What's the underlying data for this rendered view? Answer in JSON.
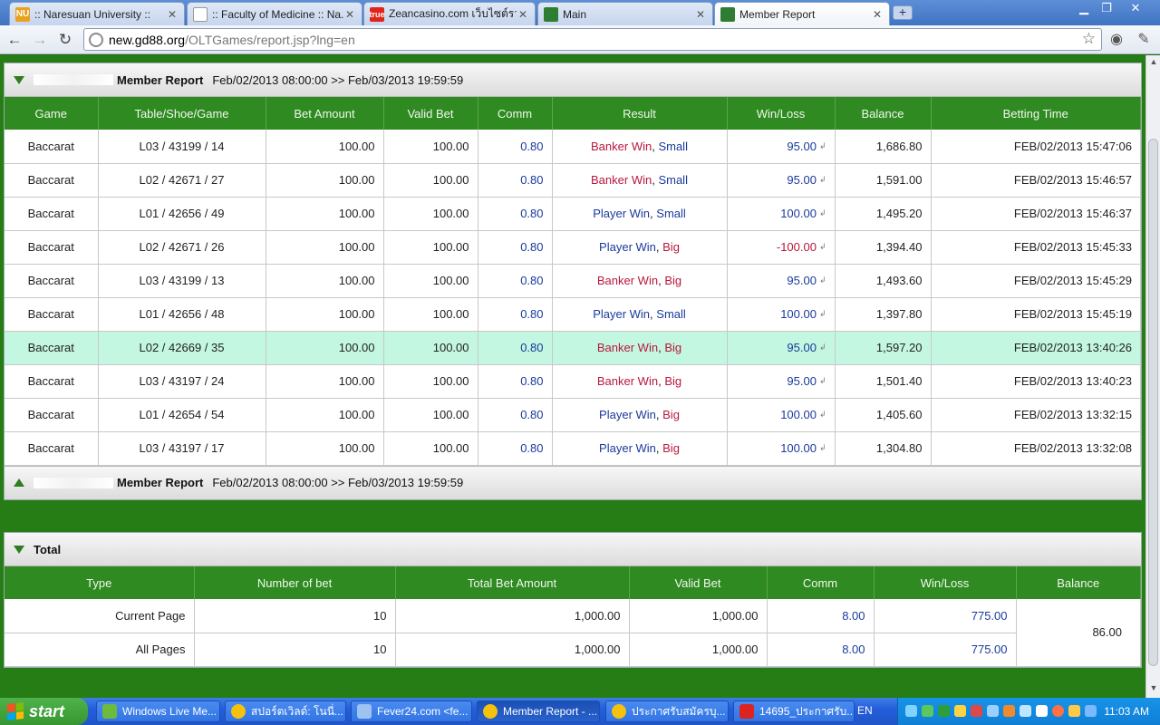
{
  "browser": {
    "tabs": [
      {
        "title": ":: Naresuan University ::",
        "fav": "NU",
        "color": "#e9a21f"
      },
      {
        "title": ":: Faculty of Medicine :: Na...",
        "fav": "",
        "color": "#ffffff"
      },
      {
        "title": "Zeancasino.com เว็บไซต์รว...",
        "fav": "true",
        "color": "#e2231a"
      },
      {
        "title": "Main",
        "fav": "",
        "color": "#2e7d32"
      },
      {
        "title": "Member Report",
        "fav": "",
        "color": "#2e7d32"
      }
    ],
    "url_host": "new.gd88.org",
    "url_path": "/OLTGames/report.jsp?lng=en"
  },
  "report1": {
    "title": "Member Report",
    "range": "Feb/02/2013 08:00:00 >> Feb/03/2013 19:59:59",
    "columns": [
      "Game",
      "Table/Shoe/Game",
      "Bet Amount",
      "Valid Bet",
      "Comm",
      "Result",
      "Win/Loss",
      "Balance",
      "Betting Time"
    ],
    "rows": [
      {
        "game": "Baccarat",
        "table": "L03 / 43199 / 14",
        "bet": "100.00",
        "valid": "100.00",
        "comm": "0.80",
        "res1": "Banker Win",
        "res2": "Small",
        "winloss": "95.00",
        "balance": "1,686.80",
        "time": "FEB/02/2013 15:47:06"
      },
      {
        "game": "Baccarat",
        "table": "L02 / 42671 / 27",
        "bet": "100.00",
        "valid": "100.00",
        "comm": "0.80",
        "res1": "Banker Win",
        "res2": "Small",
        "winloss": "95.00",
        "balance": "1,591.00",
        "time": "FEB/02/2013 15:46:57"
      },
      {
        "game": "Baccarat",
        "table": "L01 / 42656 / 49",
        "bet": "100.00",
        "valid": "100.00",
        "comm": "0.80",
        "res1": "Player Win",
        "res2": "Small",
        "winloss": "100.00",
        "balance": "1,495.20",
        "time": "FEB/02/2013 15:46:37"
      },
      {
        "game": "Baccarat",
        "table": "L02 / 42671 / 26",
        "bet": "100.00",
        "valid": "100.00",
        "comm": "0.80",
        "res1": "Player Win",
        "res2": "Big",
        "winloss": "-100.00",
        "balance": "1,394.40",
        "time": "FEB/02/2013 15:45:33"
      },
      {
        "game": "Baccarat",
        "table": "L03 / 43199 / 13",
        "bet": "100.00",
        "valid": "100.00",
        "comm": "0.80",
        "res1": "Banker Win",
        "res2": "Big",
        "winloss": "95.00",
        "balance": "1,493.60",
        "time": "FEB/02/2013 15:45:29"
      },
      {
        "game": "Baccarat",
        "table": "L01 / 42656 / 48",
        "bet": "100.00",
        "valid": "100.00",
        "comm": "0.80",
        "res1": "Player Win",
        "res2": "Small",
        "winloss": "100.00",
        "balance": "1,397.80",
        "time": "FEB/02/2013 15:45:19"
      },
      {
        "game": "Baccarat",
        "table": "L02 / 42669 / 35",
        "bet": "100.00",
        "valid": "100.00",
        "comm": "0.80",
        "res1": "Banker Win",
        "res2": "Big",
        "winloss": "95.00",
        "balance": "1,597.20",
        "time": "FEB/02/2013 13:40:26"
      },
      {
        "game": "Baccarat",
        "table": "L03 / 43197 / 24",
        "bet": "100.00",
        "valid": "100.00",
        "comm": "0.80",
        "res1": "Banker Win",
        "res2": "Big",
        "winloss": "95.00",
        "balance": "1,501.40",
        "time": "FEB/02/2013 13:40:23"
      },
      {
        "game": "Baccarat",
        "table": "L01 / 42654 / 54",
        "bet": "100.00",
        "valid": "100.00",
        "comm": "0.80",
        "res1": "Player Win",
        "res2": "Big",
        "winloss": "100.00",
        "balance": "1,405.60",
        "time": "FEB/02/2013 13:32:15"
      },
      {
        "game": "Baccarat",
        "table": "L03 / 43197 / 17",
        "bet": "100.00",
        "valid": "100.00",
        "comm": "0.80",
        "res1": "Player Win",
        "res2": "Big",
        "winloss": "100.00",
        "balance": "1,304.80",
        "time": "FEB/02/2013 13:32:08"
      }
    ]
  },
  "report2": {
    "title": "Member Report",
    "range": "Feb/02/2013 08:00:00 >> Feb/03/2013 19:59:59"
  },
  "total": {
    "title": "Total",
    "columns": [
      "Type",
      "Number of bet",
      "Total Bet Amount",
      "Valid Bet",
      "Comm",
      "Win/Loss",
      "Balance"
    ],
    "rows": [
      {
        "type": "Current Page",
        "count": "10",
        "total_bet": "1,000.00",
        "valid": "1,000.00",
        "comm": "8.00",
        "winloss": "775.00"
      },
      {
        "type": "All Pages",
        "count": "10",
        "total_bet": "1,000.00",
        "valid": "1,000.00",
        "comm": "8.00",
        "winloss": "775.00"
      }
    ],
    "balance": "86.00"
  },
  "taskbar": {
    "start": "start",
    "tasks": [
      "Windows Live Me...",
      "สปอร์ตเวิลด์: โนนี่...",
      "Fever24.com <fe...",
      "Member Report - ...",
      "ประกาศรับสมัครบุ...",
      "14695_ประกาศรับ..."
    ],
    "lang": "EN",
    "clock": "11:03 AM"
  },
  "colors": {
    "header_green": "#2f8a22",
    "win_blue": "#1a3a9c",
    "banker_red": "#b8183c",
    "highlight_row": "#c4f7e1"
  }
}
